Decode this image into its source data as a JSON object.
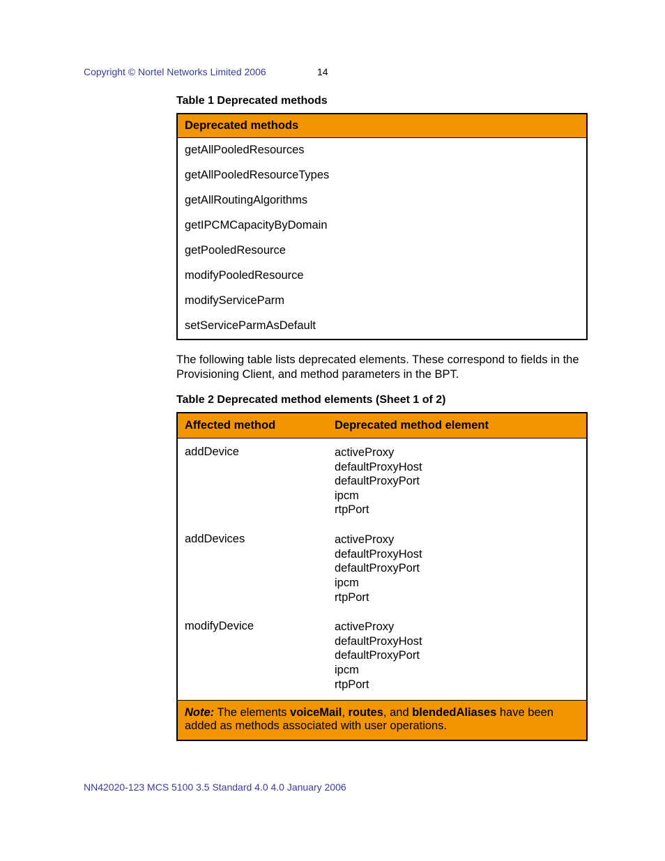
{
  "header": {
    "copyright": "Copyright © Nortel Networks Limited 2006",
    "page_number": "14"
  },
  "table1": {
    "caption": "Table 1  Deprecated methods",
    "header": "Deprecated methods",
    "rows": [
      "getAllPooledResources",
      "getAllPooledResourceTypes",
      "getAllRoutingAlgorithms",
      "getIPCMCapacityByDomain",
      "getPooledResource",
      "modifyPooledResource",
      "modifyServiceParm",
      "setServiceParmAsDefault"
    ]
  },
  "paragraph1": "The following table lists deprecated elements. These correspond to fields in the Provisioning Client, and method parameters in the BPT.",
  "table2": {
    "caption": "Table 2  Deprecated method elements  (Sheet 1 of 2)",
    "headers": {
      "col1": "Affected method",
      "col2": "Deprecated method element"
    },
    "rows": [
      {
        "method": "addDevice",
        "elements": [
          "activeProxy",
          "defaultProxyHost",
          "defaultProxyPort",
          "ipcm",
          "rtpPort"
        ]
      },
      {
        "method": "addDevices",
        "elements": [
          "activeProxy",
          "defaultProxyHost",
          "defaultProxyPort",
          "ipcm",
          "rtpPort"
        ]
      },
      {
        "method": "modifyDevice",
        "elements": [
          "activeProxy",
          "defaultProxyHost",
          "defaultProxyPort",
          "ipcm",
          "rtpPort"
        ]
      }
    ],
    "note": {
      "label": "Note:",
      "pre": "  The elements ",
      "b1": "voiceMail",
      "sep1": ", ",
      "b2": "routes",
      "sep2": ", and ",
      "b3": "blendedAliases",
      "post": "  have been added as methods associated with user operations."
    }
  },
  "footer": "NN42020-123   MCS 5100 3.5   Standard 4.0   4.0   January 2006"
}
